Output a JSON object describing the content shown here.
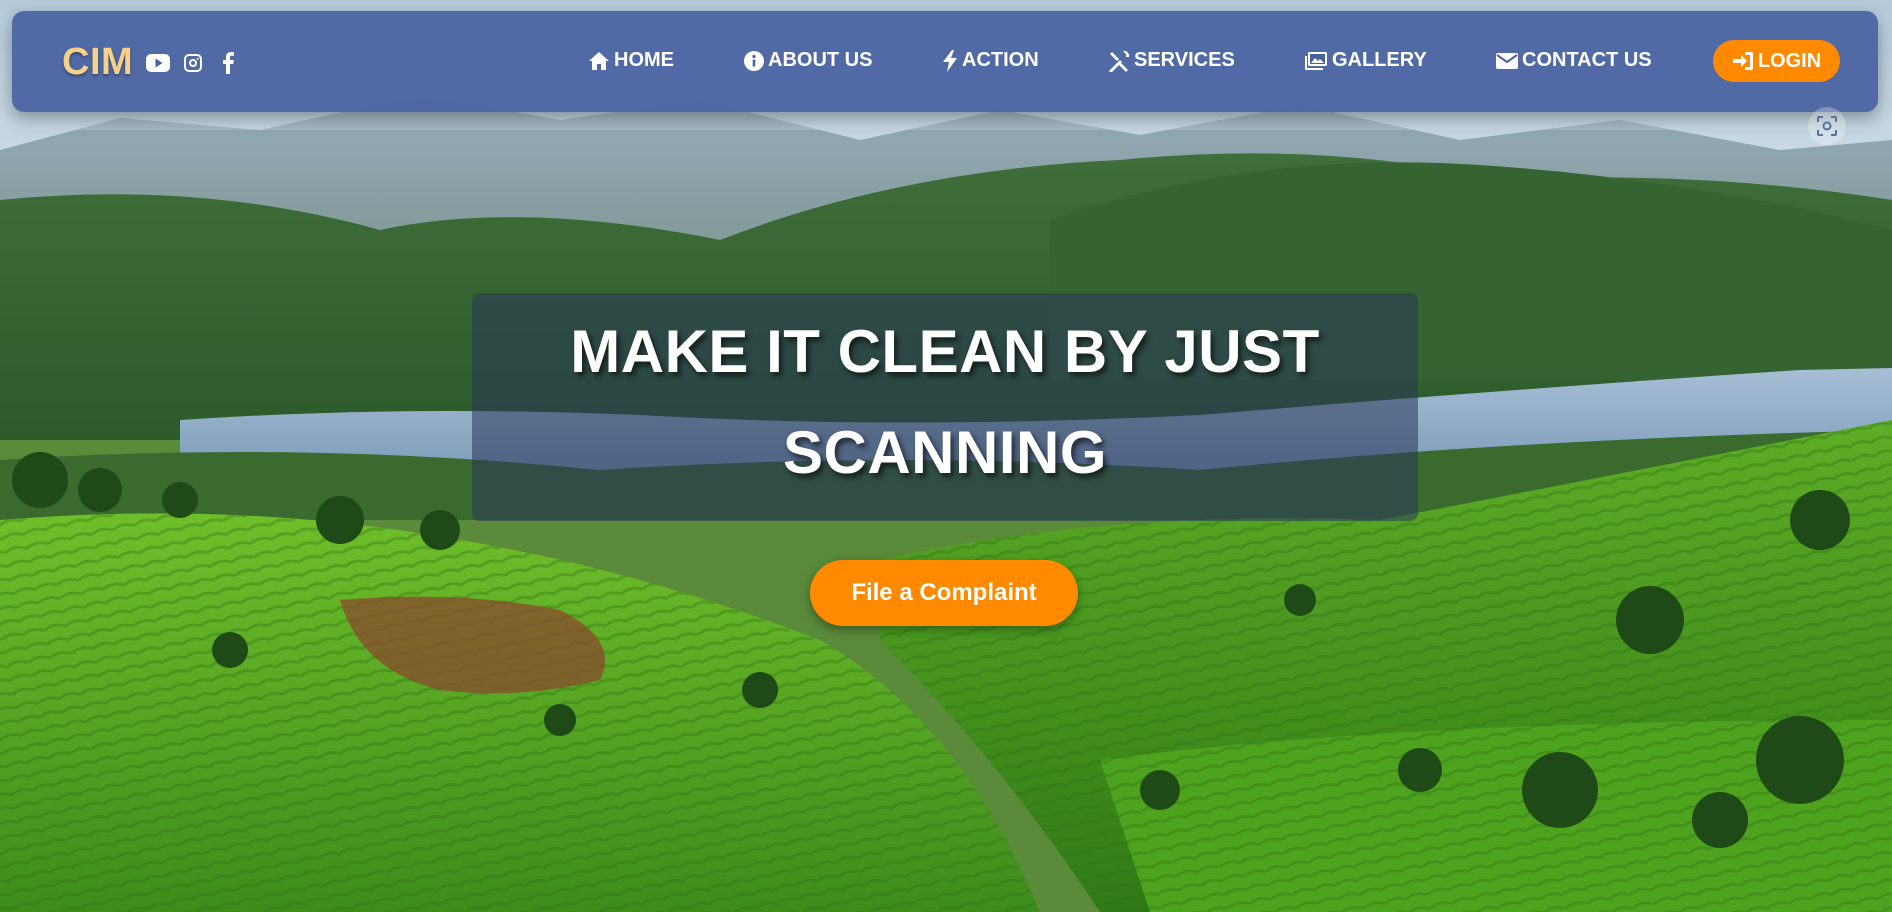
{
  "brand": {
    "name": "CIM",
    "accent_color": "#f7d08a"
  },
  "social_icons": [
    "youtube-icon",
    "instagram-icon",
    "facebook-icon"
  ],
  "nav": {
    "items": [
      {
        "label": "HOME",
        "icon": "home-icon"
      },
      {
        "label": "ABOUT US",
        "icon": "info-icon"
      },
      {
        "label": "ACTION",
        "icon": "bolt-icon"
      },
      {
        "label": "SERVICES",
        "icon": "tools-icon"
      },
      {
        "label": "GALLERY",
        "icon": "images-icon"
      },
      {
        "label": "CONTACT US",
        "icon": "envelope-icon"
      }
    ],
    "login_label": "LOGIN",
    "login_color": "#ff8a00",
    "bar_color": "#4862a0"
  },
  "hero": {
    "title_line1": "MAKE IT CLEAN BY JUST",
    "title_line2": "SCANNING",
    "cta_label": "File a Complaint",
    "cta_color": "#ff8a00"
  },
  "scan_badge_icon": "scan-icon"
}
